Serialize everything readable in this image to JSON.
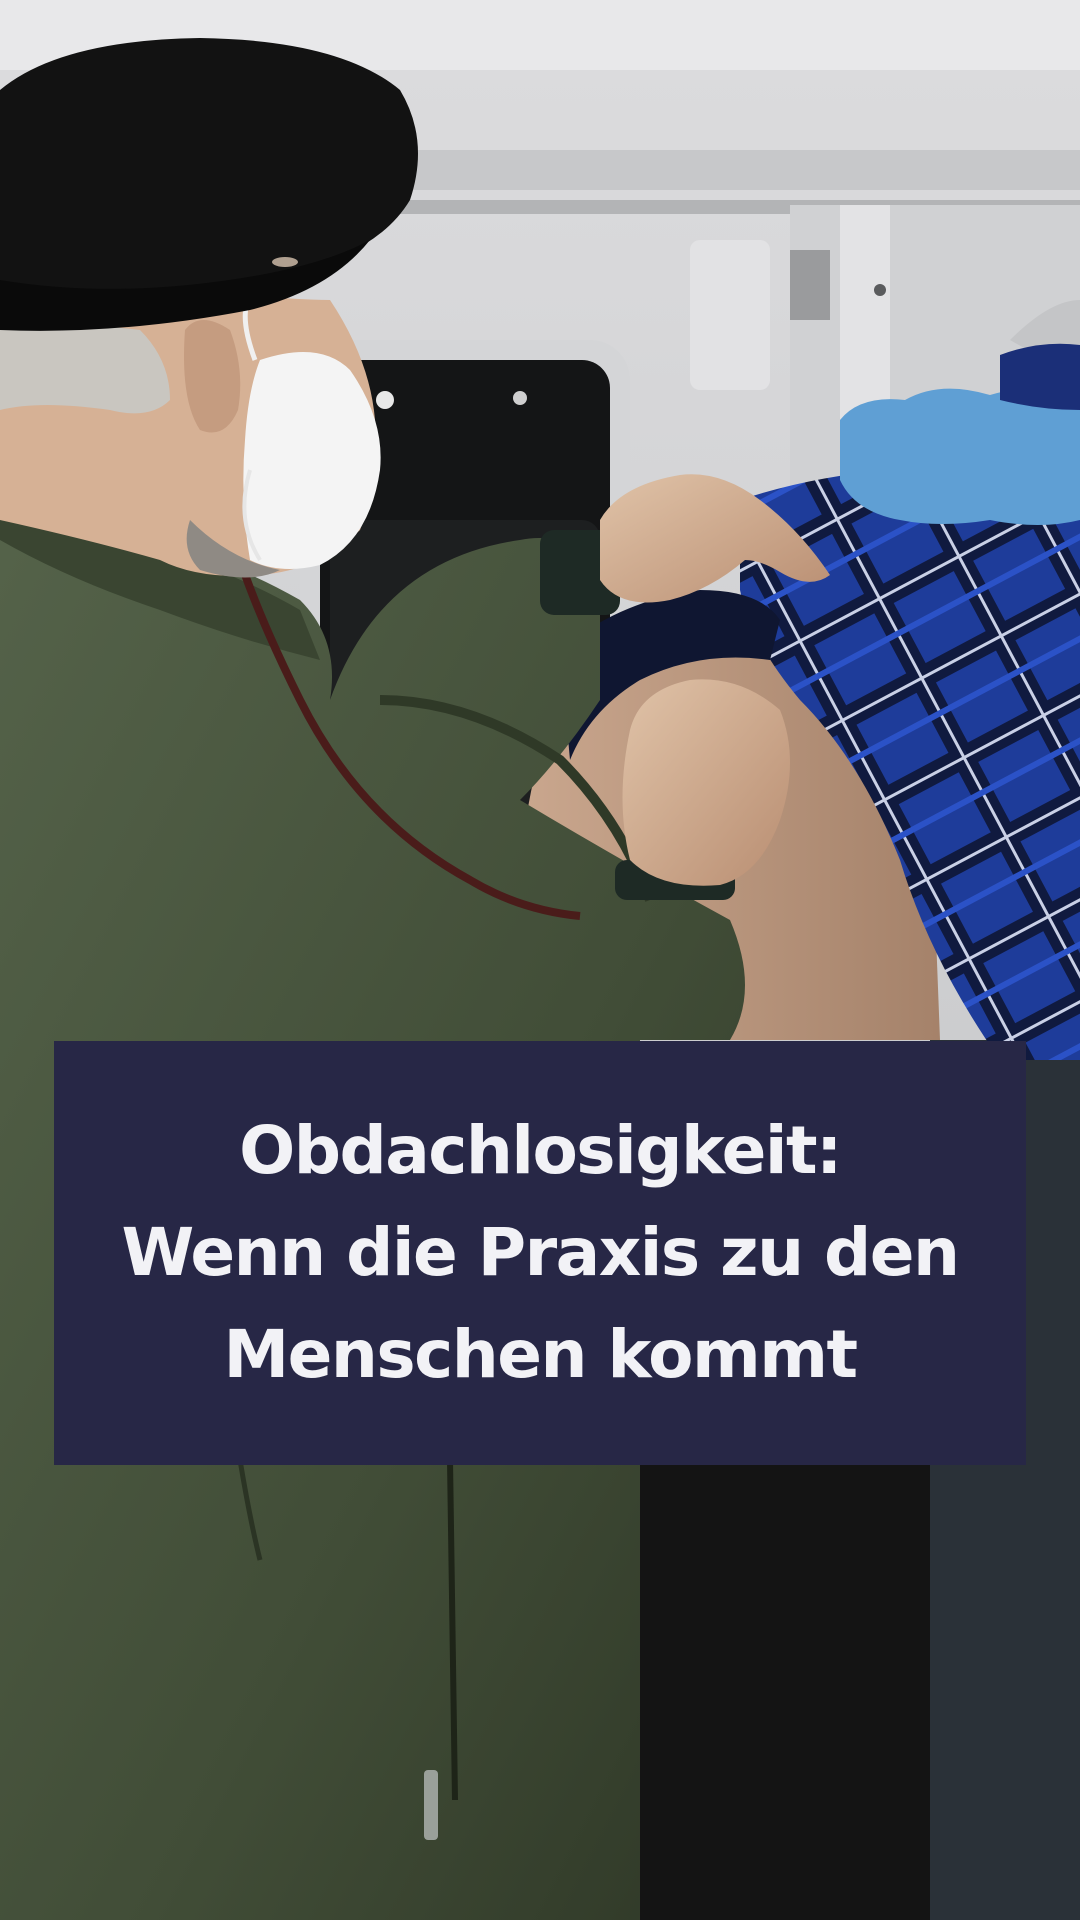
{
  "story": {
    "title_lines": [
      "Obdachlosigkeit:",
      "Wenn die Praxis zu den",
      "Menschen kommt"
    ]
  },
  "colors": {
    "title_card_background": "#272746",
    "title_text": "#f2f2f6"
  }
}
